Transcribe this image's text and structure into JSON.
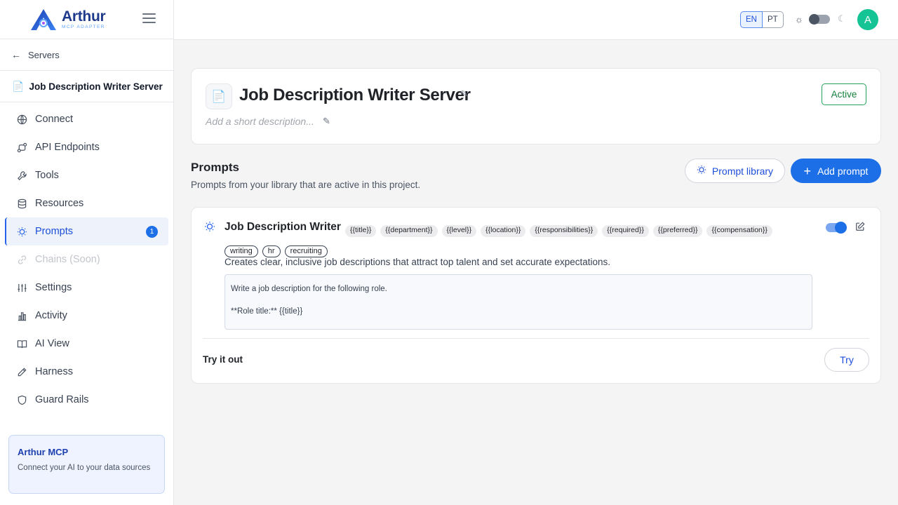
{
  "brand": {
    "name": "Arthur",
    "subtitle": "MCP ADAPTER",
    "colors": {
      "primary": "#1d6fe8",
      "navy": "#1e3a8a",
      "success": "#15803d",
      "avatar": "#14c494"
    }
  },
  "sidebar": {
    "back_label": "Servers",
    "server_name": "Job Description Writer Server",
    "items": [
      {
        "label": "Connect",
        "icon": "globe-icon",
        "state": "normal"
      },
      {
        "label": "API Endpoints",
        "icon": "api-icon",
        "state": "normal"
      },
      {
        "label": "Tools",
        "icon": "wrench-icon",
        "state": "normal"
      },
      {
        "label": "Resources",
        "icon": "database-icon",
        "state": "normal"
      },
      {
        "label": "Prompts",
        "icon": "lightbulb-icon",
        "state": "active",
        "badge": "1"
      },
      {
        "label": "Chains (Soon)",
        "icon": "link-icon",
        "state": "disabled"
      },
      {
        "label": "Settings",
        "icon": "sliders-icon",
        "state": "normal"
      },
      {
        "label": "Activity",
        "icon": "bar-chart-icon",
        "state": "normal"
      },
      {
        "label": "AI View",
        "icon": "book-icon",
        "state": "normal"
      },
      {
        "label": "Harness",
        "icon": "pen-icon",
        "state": "normal"
      },
      {
        "label": "Guard Rails",
        "icon": "shield-icon",
        "state": "normal"
      }
    ],
    "promo": {
      "title": "Arthur MCP",
      "description": "Connect your AI to your data sources"
    }
  },
  "topbar": {
    "languages": [
      "EN",
      "PT"
    ],
    "selected_language": "EN",
    "theme": "light",
    "avatar_initial": "A"
  },
  "server": {
    "title": "Job Description Writer Server",
    "description_placeholder": "Add a short description...",
    "status": "Active"
  },
  "prompts_section": {
    "title": "Prompts",
    "subtitle": "Prompts from your library that are active in this project.",
    "library_button": "Prompt library",
    "add_button": "Add prompt"
  },
  "prompt": {
    "title": "Job Description Writer",
    "variables": [
      "{{title}}",
      "{{department}}",
      "{{level}}",
      "{{location}}",
      "{{responsibilities}}",
      "{{required}}",
      "{{preferred}}",
      "{{compensation}}"
    ],
    "tags": [
      "writing",
      "hr",
      "recruiting"
    ],
    "description": "Creates clear, inclusive job descriptions that attract top talent and set accurate expectations.",
    "template_text": "Write a job description for the following role.\n\n**Role title:** {{title}}",
    "enabled": true,
    "try_label": "Try it out",
    "try_button": "Try"
  }
}
